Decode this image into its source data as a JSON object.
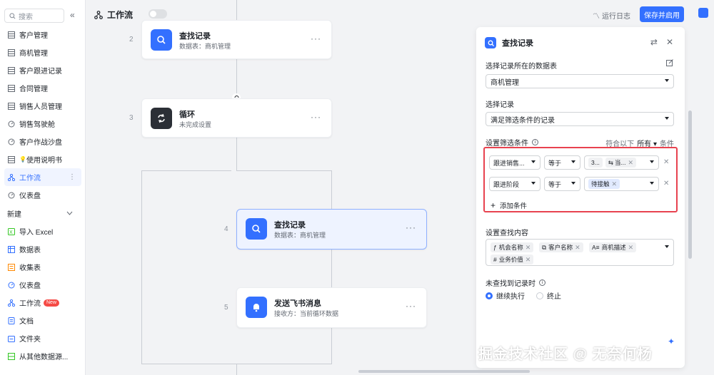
{
  "sidebar": {
    "search_placeholder": "搜索",
    "collapse": "«",
    "items": [
      {
        "label": "客户管理",
        "icon": "table-icon"
      },
      {
        "label": "商机管理",
        "icon": "table-icon"
      },
      {
        "label": "客户跟进记录",
        "icon": "table-icon"
      },
      {
        "label": "合同管理",
        "icon": "table-icon"
      },
      {
        "label": "销售人员管理",
        "icon": "table-icon"
      },
      {
        "label": "销售驾驶舱",
        "icon": "dashboard-icon"
      },
      {
        "label": "客户作战沙盘",
        "icon": "dashboard-icon"
      },
      {
        "label": "使用说明书",
        "icon": "doc-icon",
        "emoji": "💡"
      },
      {
        "label": "工作流",
        "icon": "workflow-icon",
        "active": true
      },
      {
        "label": "仪表盘",
        "icon": "dashboard-icon"
      }
    ],
    "new_section": "新建",
    "new_items": [
      {
        "label": "导入 Excel",
        "icon": "excel-icon"
      },
      {
        "label": "数据表",
        "icon": "table-icon"
      },
      {
        "label": "收集表",
        "icon": "form-icon"
      },
      {
        "label": "仪表盘",
        "icon": "dashboard-icon"
      },
      {
        "label": "工作流",
        "icon": "workflow-icon",
        "badge": "New"
      },
      {
        "label": "文档",
        "icon": "doc-icon"
      },
      {
        "label": "文件夹",
        "icon": "folder-icon"
      },
      {
        "label": "从其他数据源...",
        "icon": "datasource-icon"
      }
    ]
  },
  "topbar": {
    "title": "工作流",
    "run_log": "运行日志",
    "save_button": "保存并启用"
  },
  "flow": {
    "steps": [
      {
        "num": "2",
        "title": "查找记录",
        "subtitle": "数据表：商机管理",
        "icon": "search-icon"
      },
      {
        "num": "3",
        "title": "循环",
        "subtitle": "未完成设置",
        "icon": "loop-icon"
      },
      {
        "num": "4",
        "title": "查找记录",
        "subtitle": "数据表：商机管理",
        "icon": "search-icon"
      },
      {
        "num": "5",
        "title": "发送飞书消息",
        "subtitle": "接收方：当前循环数据",
        "icon": "bell-icon"
      }
    ]
  },
  "panel": {
    "title": "查找记录",
    "table_label": "选择记录所在的数据表",
    "table_value": "商机管理",
    "record_label": "选择记录",
    "record_value": "满足筛选条件的记录",
    "filter_label": "设置筛选条件",
    "match_prefix": "符合以下",
    "match_value": "所有",
    "match_suffix": "条件",
    "conditions": [
      {
        "field": "跟进销售...",
        "op": "等于",
        "values": [
          "3...",
          "当..."
        ]
      },
      {
        "field": "跟进阶段",
        "op": "等于",
        "values": [
          "待接触"
        ]
      }
    ],
    "add_condition": "添加条件",
    "content_label": "设置查找内容",
    "content_fields": [
      "机会名称",
      "客户名称",
      "商机描述",
      "业务价值"
    ],
    "not_found_label": "未查找到记录时",
    "options": [
      "继续执行",
      "终止"
    ],
    "selected_option": "继续执行"
  },
  "watermark": "掘金技术社区 @ 无奈何杨",
  "colors": {
    "accent": "#3370ff",
    "highlight_border": "#e8424f"
  }
}
